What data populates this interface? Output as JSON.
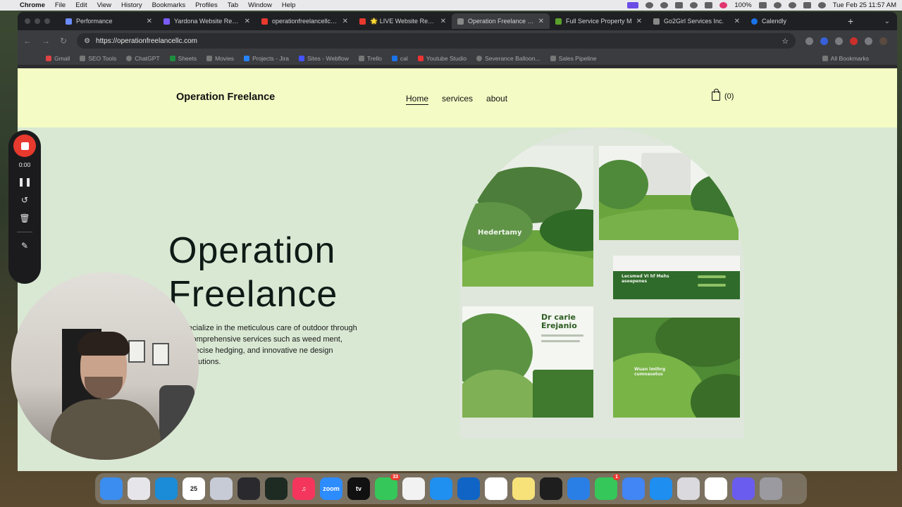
{
  "menubar": {
    "app_name": "Chrome",
    "items": [
      "File",
      "Edit",
      "View",
      "History",
      "Bookmarks",
      "Profiles",
      "Tab",
      "Window",
      "Help"
    ],
    "battery": "100%",
    "datetime": "Tue Feb 25  11:57 AM"
  },
  "browser": {
    "tabs": [
      {
        "title": "Performance",
        "favicon_color": "#6b8cff"
      },
      {
        "title": "Yardona Website Review",
        "favicon_color": "#7b5cff"
      },
      {
        "title": "operationfreelancellc.co",
        "favicon_color": "#e8392e"
      },
      {
        "title": "🌟 LIVE Website Review",
        "favicon_color": "#e8392e"
      },
      {
        "title": "Operation Freelance - L",
        "favicon_color": "#888888"
      },
      {
        "title": "Full Service Property M",
        "favicon_color": "#5aa02c"
      },
      {
        "title": "Go2Girl Services Inc.",
        "favicon_color": "#888888"
      },
      {
        "title": "Calendly",
        "favicon_color": "#1a73e8"
      }
    ],
    "active_tab_index": 4,
    "url": "https://operationfreelancellc.com",
    "bookmarks": [
      "Gmail",
      "SEO Tools",
      "ChatGPT",
      "Sheets",
      "Movies",
      "Projects - Jira",
      "Sites - Webflow",
      "Trello",
      "cal",
      "Youtube Studio",
      "Severance Balloon...",
      "Sales Pipeline"
    ],
    "all_bookmarks_label": "All Bookmarks"
  },
  "site": {
    "brand": "Operation Freelance",
    "nav": [
      "Home",
      "services",
      "about"
    ],
    "active_nav": "Home",
    "cart_label": "(0)",
    "hero_title_line1": "Operation",
    "hero_title_line2": "Freelance",
    "hero_text": "ecialize in the meticulous care of outdoor  through comprehensive services such as weed ment, precise hedging, and innovative ne design solutions.",
    "collage_labels": [
      "Hedertamy",
      "Dr carie Erejanio",
      "Lecsmed VI hf Mehs aseepenes",
      "Wuan Imthrg cumnasetus"
    ],
    "accent_color": "#6aa43d",
    "header_bg": "#f4fbc4",
    "page_bg": "#d9e8d3"
  },
  "recorder": {
    "time": "0:00"
  },
  "dock": {
    "apps": [
      {
        "name": "Finder",
        "color": "#3b8df0",
        "label": ""
      },
      {
        "name": "Launchpad",
        "color": "#e6e6ea",
        "label": ""
      },
      {
        "name": "Edge",
        "color": "#1a8cd8",
        "label": ""
      },
      {
        "name": "Calendar",
        "color": "#ffffff",
        "label": "25"
      },
      {
        "name": "Preview",
        "color": "#c6cbd6",
        "label": ""
      },
      {
        "name": "OBS",
        "color": "#2a2a2e",
        "label": ""
      },
      {
        "name": "Activity Monitor",
        "color": "#1d2b23",
        "label": ""
      },
      {
        "name": "Music",
        "color": "#f5365c",
        "label": "♫"
      },
      {
        "name": "Zoom",
        "color": "#2d8cff",
        "label": "zoom"
      },
      {
        "name": "Apple TV",
        "color": "#111111",
        "label": "tv"
      },
      {
        "name": "Messages",
        "color": "#35c759",
        "label": "",
        "badge": "33"
      },
      {
        "name": "Chrome",
        "color": "#f2f2f2",
        "label": ""
      },
      {
        "name": "Safari",
        "color": "#1f8ff0",
        "label": ""
      },
      {
        "name": "Outlook",
        "color": "#0f64c6",
        "label": ""
      },
      {
        "name": "Slack",
        "color": "#ffffff",
        "label": ""
      },
      {
        "name": "Notes",
        "color": "#f7e27a",
        "label": ""
      },
      {
        "name": "Figma",
        "color": "#1e1e1e",
        "label": ""
      },
      {
        "name": "Screenflow",
        "color": "#2a7fe6",
        "label": ""
      },
      {
        "name": "FaceTime",
        "color": "#35c759",
        "label": "",
        "badge": "1"
      },
      {
        "name": "Docs",
        "color": "#4285f4",
        "label": ""
      },
      {
        "name": "App Store",
        "color": "#1e8ef0",
        "label": ""
      },
      {
        "name": "iPhone Mirroring",
        "color": "#d9d9de",
        "label": ""
      },
      {
        "name": "Photos",
        "color": "#ffffff",
        "label": ""
      },
      {
        "name": "ChatGPT",
        "color": "#6b5cf0",
        "label": ""
      },
      {
        "name": "Trash",
        "color": "#9a9aa0",
        "label": ""
      }
    ]
  }
}
